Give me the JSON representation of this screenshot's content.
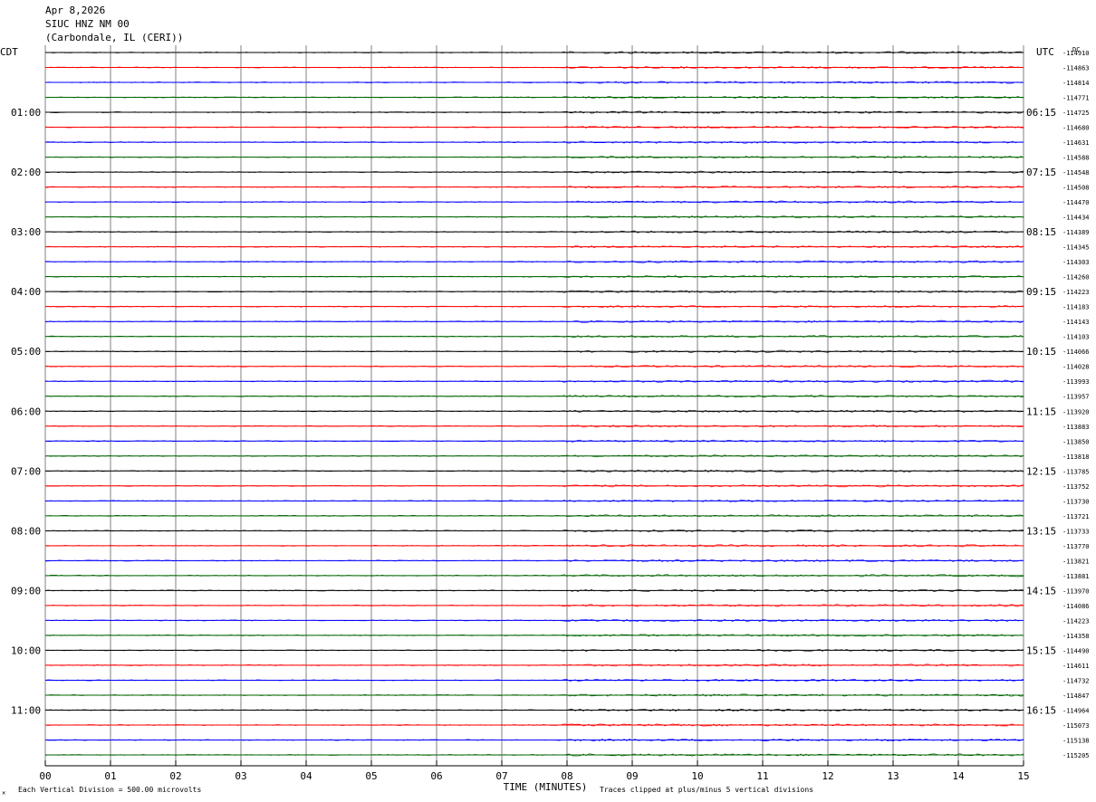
{
  "header": {
    "date": "Apr 8,2026",
    "station": "SIUC HNZ NM 00",
    "location": "(Carbondale, IL (CERI))"
  },
  "left_axis_label": "CDT",
  "right_axis_label": "UTC",
  "dc_label": "DC",
  "footer": {
    "scale_note": "Each Vertical Division =  500.00 microvolts",
    "clip_note": "Traces clipped at plus/minus 5 vertical divisions"
  },
  "colors": {
    "trace_cycle": [
      "#000000",
      "#ff0000",
      "#0000ff",
      "#006400"
    ],
    "grid": "#808080"
  },
  "chart_data": {
    "type": "line",
    "xlabel": "TIME (MINUTES)",
    "xlim": [
      0,
      15
    ],
    "x_ticks": [
      "00",
      "01",
      "02",
      "03",
      "04",
      "05",
      "06",
      "07",
      "08",
      "09",
      "10",
      "11",
      "12",
      "13",
      "14",
      "15"
    ],
    "hour_labels_left": [
      "01:00",
      "02:00",
      "03:00",
      "04:00",
      "05:00",
      "06:00",
      "07:00",
      "08:00",
      "09:00",
      "10:00",
      "11:00"
    ],
    "hour_labels_right": [
      "06:15",
      "07:15",
      "08:15",
      "09:15",
      "10:15",
      "11:15",
      "12:15",
      "13:15",
      "14:15",
      "15:15",
      "16:15"
    ],
    "trace_dc_values": [
      "-114910",
      "-114863",
      "-114814",
      "-114771",
      "-114725",
      "-114680",
      "-114631",
      "-114588",
      "-114548",
      "-114508",
      "-114470",
      "-114434",
      "-114389",
      "-114345",
      "-114303",
      "-114260",
      "-114223",
      "-114183",
      "-114143",
      "-114103",
      "-114066",
      "-114028",
      "-113993",
      "-113957",
      "-113920",
      "-113883",
      "-113850",
      "-113818",
      "-113785",
      "-113752",
      "-113730",
      "-113721",
      "-113733",
      "-113770",
      "-113821",
      "-113881",
      "-113970",
      "-114086",
      "-114223",
      "-114358",
      "-114490",
      "-114611",
      "-114732",
      "-114847",
      "-114964",
      "-115073",
      "-115138",
      "-115205"
    ]
  }
}
